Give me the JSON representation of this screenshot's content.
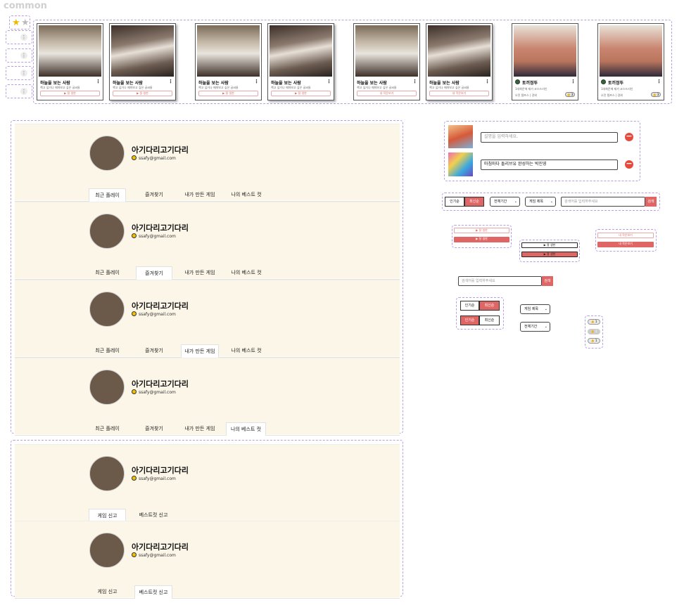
{
  "page": {
    "title": "common"
  },
  "cards": {
    "woman_title": "하늘을 보는 사람",
    "woman_desc": "책고 싶거나 깨져보고 싶은 글씨들",
    "man_title": "토끼정뚜",
    "man_desc": "1대화문에 재가 코스드리인",
    "man_by": "오전 템프스 | 경위",
    "btn_play": "▶ 잘 생한",
    "btn_result": "내 작은보기",
    "like_label": "👍 3"
  },
  "profile": {
    "nickname": "아기다리고기다리",
    "email": "ssafy@gmail.com",
    "tabs": [
      "최근 플레이",
      "즐겨찾기",
      "내가 만든 게임",
      "나의 베스트 컷"
    ],
    "report_tabs": [
      "게임 신고",
      "베스트컷 신고"
    ]
  },
  "inputs": {
    "caption_placeholder": "설명을 입력하세요.",
    "caption_value": "마침마다 돌리브유 완성하는 박진영"
  },
  "filter": {
    "sort_popular": "인기순",
    "sort_latest": "최신순",
    "period": "전체기간",
    "scope": "게임 제목",
    "search_placeholder": "검색어를 입력하주세요",
    "search_btn": "검색"
  },
  "small": {
    "search_placeholder": "검색어를 입력하주세요",
    "search_btn": "검색",
    "scope": "게임 제목",
    "period": "전체기간",
    "play": "▶ 잘 생한",
    "result": "내 작은보기",
    "like": "👍 1"
  },
  "colors": {
    "accent": "#e06666",
    "panel_bg": "#fbf6e8",
    "dash": "#b79fe6"
  }
}
